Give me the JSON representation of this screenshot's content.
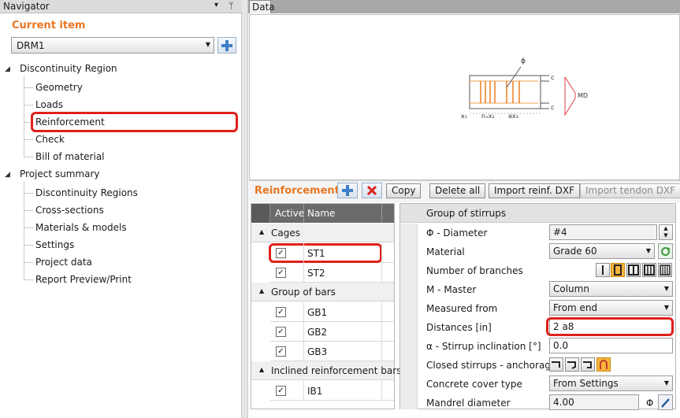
{
  "navigator": {
    "title": "Navigator",
    "pin_glyph": "▾",
    "pin2_glyph": "ᛘ",
    "current_item_label": "Current item",
    "current_item_value": "DRM1",
    "tree": {
      "section1": "Discontinuity Region",
      "section1_items": [
        "Geometry",
        "Loads",
        "Reinforcement",
        "Check",
        "Bill of material"
      ],
      "section2": "Project summary",
      "section2_items": [
        "Discontinuity Regions",
        "Cross-sections",
        "Materials & models",
        "Settings",
        "Project data",
        "Report Preview/Print"
      ]
    }
  },
  "tabs": {
    "data": "Data"
  },
  "diagram": {
    "label_phi": "ϕ",
    "label_c_top": "c",
    "label_c_bottom": "c",
    "label_md": "MD",
    "label_x1": "x₁",
    "label_nx2": "nₓx₂",
    "label_ax3": "ax₃"
  },
  "reinforcement": {
    "title": "Reinforcement",
    "copy_label": "Copy",
    "delete_all_label": "Delete all",
    "import_dxf_label": "Import reinf. DXF",
    "import_tendon_label": "Import tendon DXF"
  },
  "table": {
    "col_active": "Active",
    "col_name": "Name",
    "groups": [
      {
        "label": "Cages",
        "rows": [
          "ST1",
          "ST2"
        ]
      },
      {
        "label": "Group of bars",
        "rows": [
          "GB1",
          "GB2",
          "GB3"
        ]
      },
      {
        "label": "Inclined reinforcement bars",
        "rows": [
          "IB1"
        ]
      }
    ],
    "check_glyph": "✓",
    "expand_glyph": "▲"
  },
  "props": {
    "header": "Group of stirrups",
    "diameter_label": "Φ - Diameter",
    "diameter_value": "#4",
    "material_label": "Material",
    "material_value": "Grade 60",
    "branches_label": "Number of branches",
    "master_label": "M - Master",
    "master_value": "Column",
    "measured_label": "Measured from",
    "measured_value": "From end",
    "distances_label": "Distances [in]",
    "distances_value": "2 a8",
    "incl_label": "α - Stirrup inclination [°]",
    "incl_value": "0.0",
    "closed_label": "Closed stirrups - anchorage",
    "cover_label": "Concrete cover type",
    "cover_value": "From Settings",
    "mandrel_label": "Mandrel diameter",
    "mandrel_value": "4.00",
    "mandrel_unit": "Φ"
  },
  "colors": {
    "accent": "#e87722",
    "highlight": "#e0201b",
    "selected_icon": "#f7b43a"
  }
}
